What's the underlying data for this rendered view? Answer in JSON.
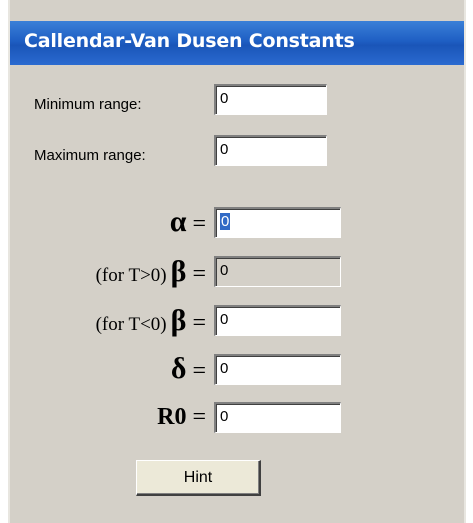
{
  "window": {
    "title": "Callendar-Van Dusen Constants"
  },
  "range": {
    "min_label": "Minimum range:",
    "min_value": "0",
    "max_label": "Maximum range:",
    "max_value": "0"
  },
  "constants": {
    "alpha": {
      "prefix": "",
      "symbol": "α",
      "equals": " =",
      "value": "0"
    },
    "beta_pos": {
      "prefix": "(for T>0)",
      "symbol": "β",
      "equals": " =",
      "value": "0"
    },
    "beta_neg": {
      "prefix": "(for T<0)",
      "symbol": "β",
      "equals": " =",
      "value": "0"
    },
    "delta": {
      "prefix": "",
      "symbol": "δ",
      "equals": " =",
      "value": "0"
    },
    "r0": {
      "prefix": "",
      "symbol": "R0",
      "equals": " =",
      "value": "0"
    }
  },
  "buttons": {
    "hint_label": "Hint"
  }
}
